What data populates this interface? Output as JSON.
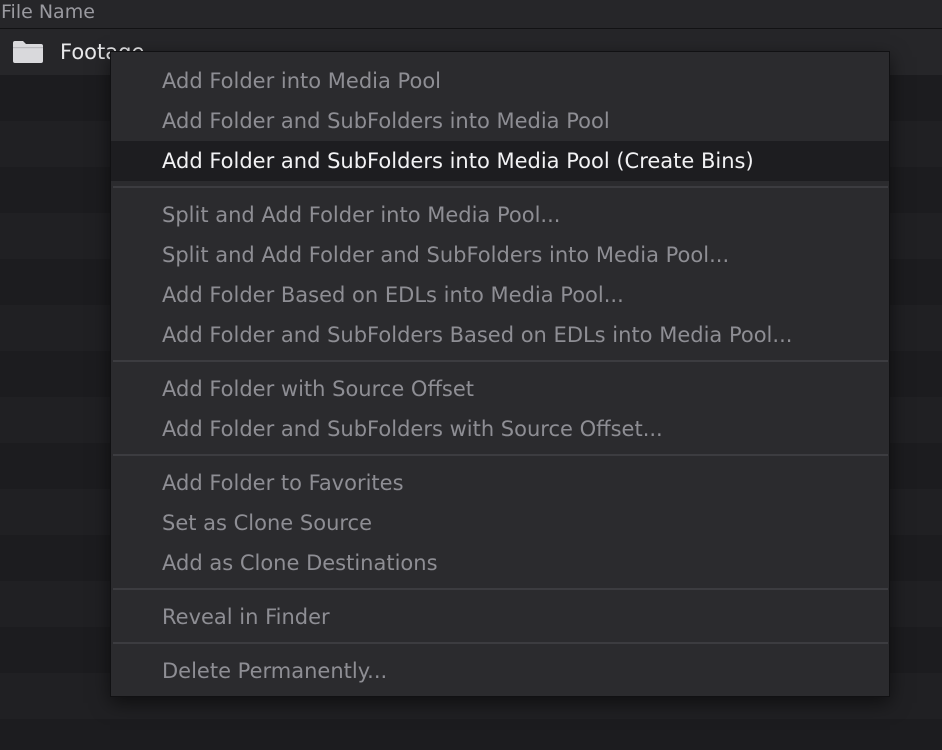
{
  "header": {
    "file_name_label": "File Name"
  },
  "file_rows": [
    {
      "label": "Footage",
      "icon": "folder-icon"
    }
  ],
  "context_menu": {
    "groups": [
      [
        {
          "label": "Add Folder into Media Pool",
          "highlighted": false
        },
        {
          "label": "Add Folder and SubFolders into Media Pool",
          "highlighted": false
        },
        {
          "label": "Add Folder and SubFolders into Media Pool (Create Bins)",
          "highlighted": true
        }
      ],
      [
        {
          "label": "Split and Add Folder into Media Pool...",
          "highlighted": false
        },
        {
          "label": "Split and Add Folder and SubFolders into Media Pool...",
          "highlighted": false
        },
        {
          "label": "Add Folder Based on EDLs into Media Pool...",
          "highlighted": false
        },
        {
          "label": "Add Folder and SubFolders Based on EDLs into Media Pool...",
          "highlighted": false
        }
      ],
      [
        {
          "label": "Add Folder with Source Offset",
          "highlighted": false
        },
        {
          "label": "Add Folder and SubFolders with Source Offset...",
          "highlighted": false
        }
      ],
      [
        {
          "label": "Add Folder to Favorites",
          "highlighted": false
        },
        {
          "label": "Set as Clone Source",
          "highlighted": false
        },
        {
          "label": "Add as Clone Destinations",
          "highlighted": false
        }
      ],
      [
        {
          "label": "Reveal in Finder",
          "highlighted": false
        }
      ],
      [
        {
          "label": "Delete Permanently...",
          "highlighted": false
        }
      ]
    ]
  },
  "colors": {
    "menu_background": "#2b2b2e",
    "menu_highlight": "#1d1d20",
    "text_disabled": "#8e8e94",
    "text_active": "#f2f2f4",
    "folder_icon": "#d9d9dc"
  }
}
